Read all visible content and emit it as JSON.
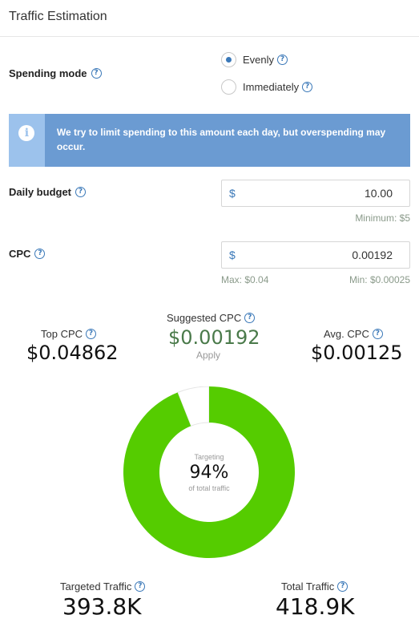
{
  "header": {
    "title": "Traffic Estimation"
  },
  "spending_mode": {
    "label": "Spending mode",
    "options": [
      {
        "label": "Evenly",
        "selected": true
      },
      {
        "label": "Immediately",
        "selected": false
      }
    ]
  },
  "info_banner": {
    "text": "We try to limit spending to this amount each day, but overspending may occur."
  },
  "daily_budget": {
    "label": "Daily budget",
    "prefix": "$",
    "value": "10.00",
    "minimum_hint": "Minimum: $5"
  },
  "cpc": {
    "label": "CPC",
    "prefix": "$",
    "value": "0.00192",
    "max_hint": "Max: $0.04",
    "min_hint": "Min: $0.00025"
  },
  "stats": {
    "top_cpc_label": "Top CPC",
    "top_cpc_value": "$0.04862",
    "suggested_cpc_label": "Suggested CPC",
    "suggested_cpc_value": "$0.00192",
    "apply_label": "Apply",
    "avg_cpc_label": "Avg. CPC",
    "avg_cpc_value": "$0.00125"
  },
  "donut": {
    "top_text": "Targeting",
    "percent_text": "94%",
    "bottom_text": "of total traffic",
    "fraction": 0.94,
    "fill_color": "#55cc00",
    "rest_color": "#ffffff"
  },
  "traffic": {
    "targeted_label": "Targeted Traffic",
    "targeted_value": "393.8K",
    "total_label": "Total Traffic",
    "total_value": "418.9K"
  },
  "colors": {
    "accent": "#3a78b8",
    "banner": "#6b9bd2",
    "banner_icon_bg": "#9cc2ec",
    "suggested": "#4a7a4a"
  }
}
